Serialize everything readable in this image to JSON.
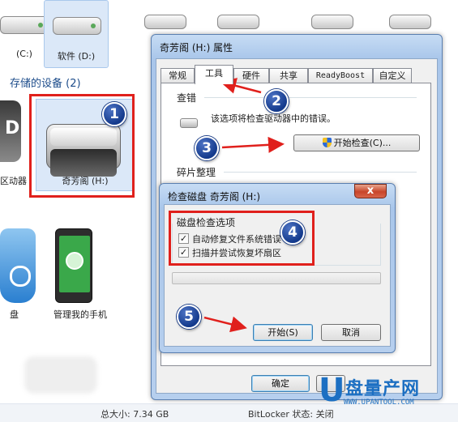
{
  "explorer": {
    "drives": [
      {
        "label": "(C:)",
        "icon": "hard-drive-icon"
      },
      {
        "label": "软件 (D:)",
        "icon": "hard-drive-icon"
      }
    ],
    "devices_section_title": "存储的设备 (2)",
    "left_partial_label": "D",
    "left_partial_name": "区动器",
    "selected_device_label": "奇芳阁 (H:)",
    "left_bottom_label": "盘",
    "phone_label": "管理我的手机",
    "status": {
      "total_size": "总大小: 7.34 GB",
      "bitlocker": "BitLocker 状态: 关闭"
    }
  },
  "properties_dialog": {
    "title": "奇芳阁 (H:) 属性",
    "tabs": [
      "常规",
      "工具",
      "硬件",
      "共享",
      "ReadyBoost",
      "自定义"
    ],
    "active_tab": "工具",
    "error_check": {
      "heading": "查错",
      "description": "该选项将检查驱动器中的错误。",
      "button": "开始检查(C)..."
    },
    "defrag": {
      "heading": "碎片整理"
    },
    "ok_button": "确定"
  },
  "check_disk_dialog": {
    "title": "检查磁盘 奇芳阁 (H:)",
    "group_title": "磁盘检查选项",
    "options": [
      {
        "label": "自动修复文件系统错误",
        "checked": true
      },
      {
        "label": "扫描并尝试恢复坏扇区",
        "checked": true
      }
    ],
    "progress": 0,
    "start_button": "开始(S)",
    "cancel_button": "取消",
    "close_glyph": "x"
  },
  "annotations": [
    "1",
    "2",
    "3",
    "4",
    "5"
  ],
  "watermark": {
    "name": "盘量产网",
    "url": "WWW.UPANTOOL.COM"
  },
  "colors": {
    "annotation_red": "#e0201c",
    "badge_blue": "#1d3f88",
    "selection": "#dbe8f8",
    "watermark_blue": "#1c6fc2"
  }
}
